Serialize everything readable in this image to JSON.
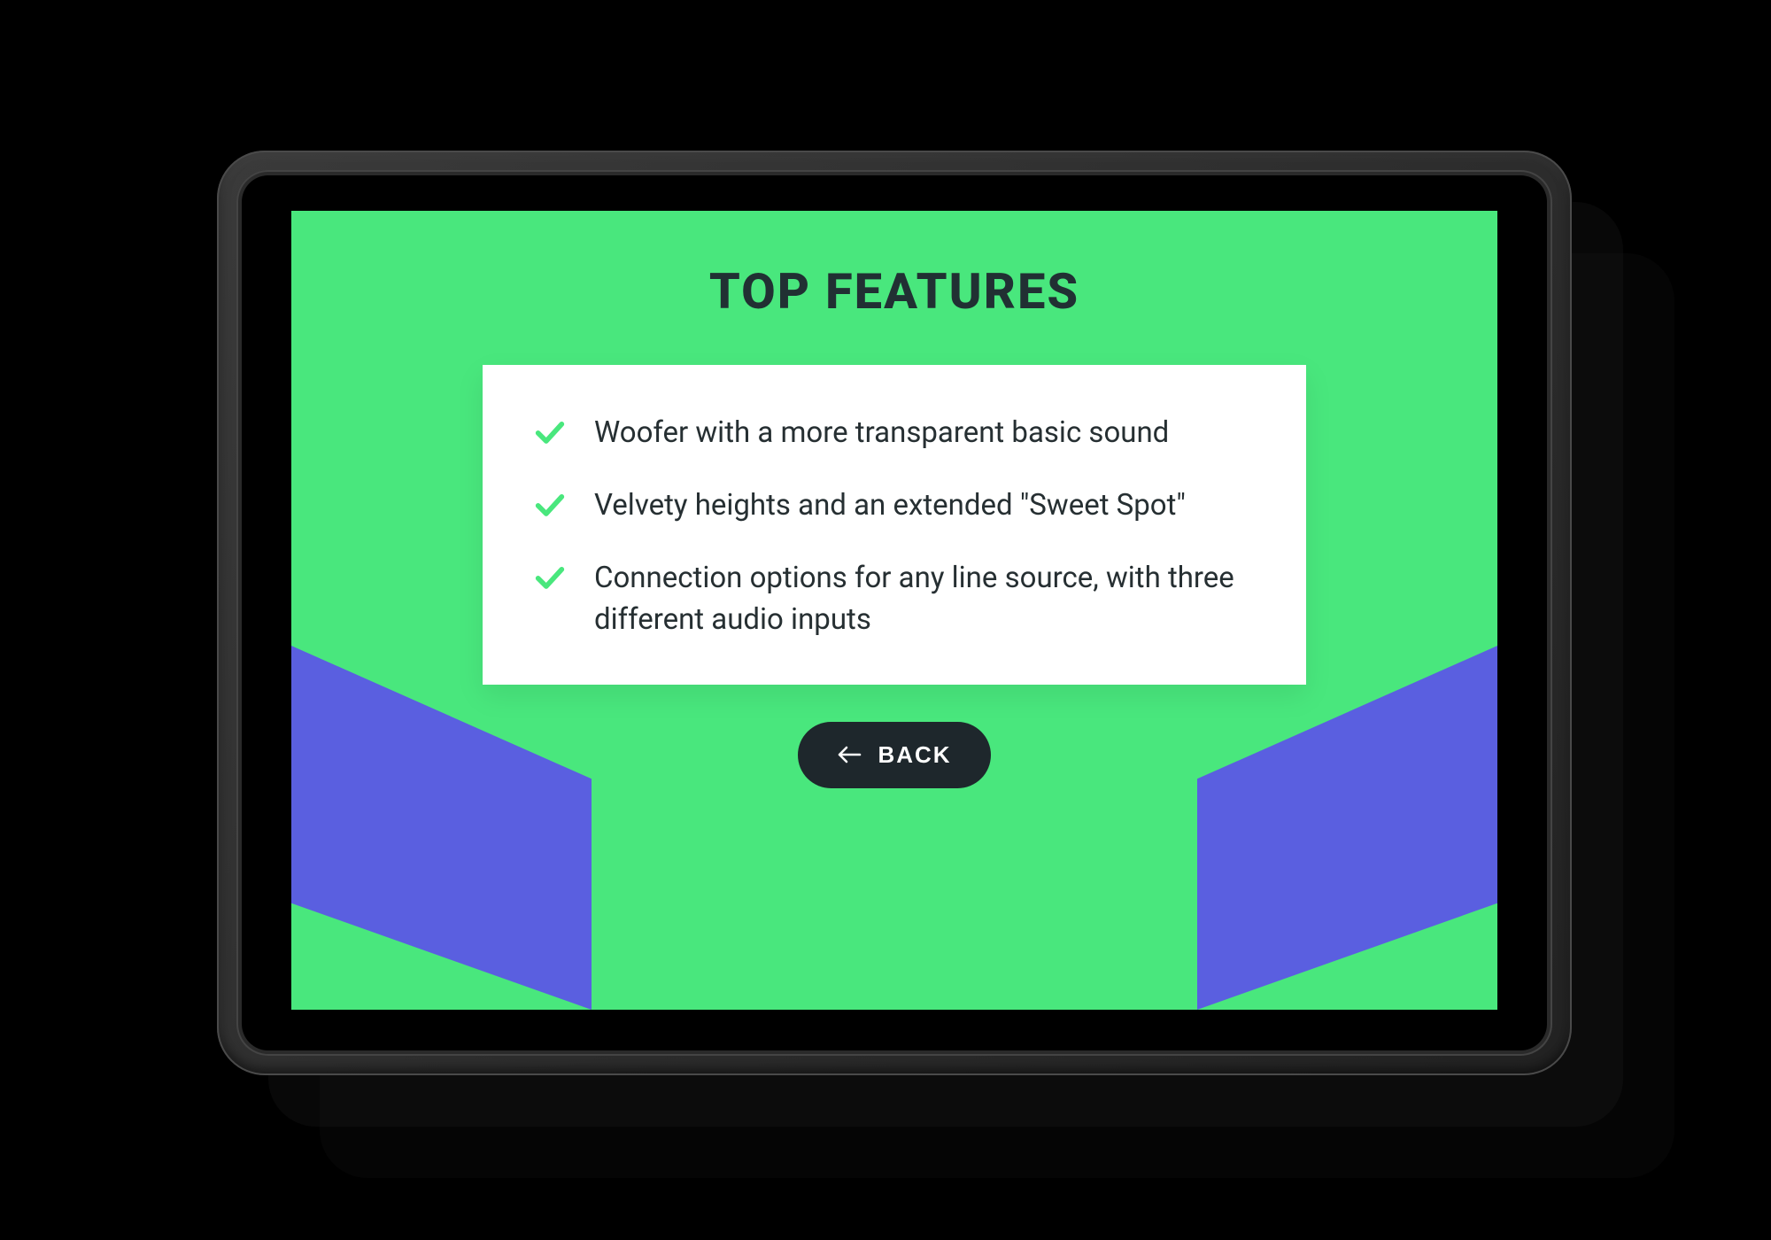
{
  "colors": {
    "screen_bg": "#49e77d",
    "accent_blue": "#5a5fe0",
    "title_text": "#213033",
    "body_text": "#262f32",
    "check_stroke": "#49e77d",
    "button_bg": "#1e272c",
    "button_text": "#ffffff"
  },
  "header": {
    "title": "TOP FEATURES"
  },
  "features": [
    {
      "text": "Woofer with a more transparent basic sound"
    },
    {
      "text": "Velvety heights and an extended \"Sweet Spot\""
    },
    {
      "text": "Connection options for any line source, with three different audio inputs"
    }
  ],
  "actions": {
    "back_label": "BACK"
  },
  "icons": {
    "check": "check-icon",
    "back_arrow": "arrow-left-icon",
    "camera": "camera-dot-icon"
  }
}
